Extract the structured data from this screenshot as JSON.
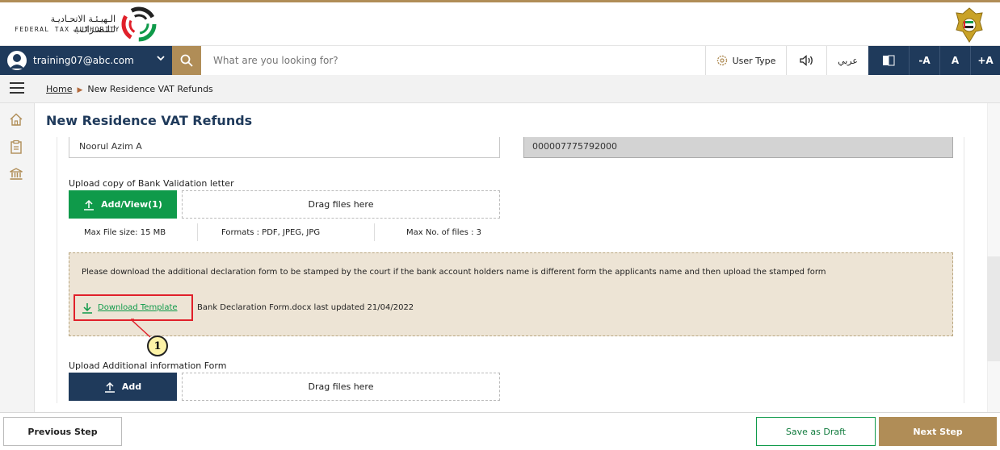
{
  "header": {
    "logo_arabic": "الـهيـئـة الاتحـاديـة لـلـضـرائـب",
    "logo_english": "FEDERAL TAX AUTHORITY"
  },
  "navbar": {
    "user_email": "training07@abc.com",
    "search_placeholder": "What are you looking for?",
    "user_type_label": "User Type",
    "arabic_label": "عربي",
    "font_decrease": "-A",
    "font_normal": "A",
    "font_increase": "+A"
  },
  "breadcrumb": {
    "home": "Home",
    "current": "New Residence VAT Refunds"
  },
  "page": {
    "title": "New Residence VAT Refunds"
  },
  "form": {
    "account_holder_value": "Noorul Azim A",
    "account_number_value": "000007775792000",
    "bank_letter": {
      "label": "Upload copy of Bank Validation letter",
      "button": "Add/View(1)",
      "dropzone": "Drag files here",
      "max_size": "Max File size: 15 MB",
      "formats": "Formats : PDF, JPEG, JPG",
      "max_files": "Max No. of files : 3"
    },
    "notice": {
      "text": "Please download the additional declaration form to be stamped by the court if the bank account holders name is different form the applicants name and then upload the stamped form",
      "download_label": "Download Template",
      "file_info": "Bank Declaration Form.docx last updated 21/04/2022"
    },
    "callout_number": "1",
    "additional_form": {
      "label": "Upload Additional information Form",
      "button": "Add",
      "dropzone": "Drag files here"
    }
  },
  "footer": {
    "previous": "Previous Step",
    "save_draft": "Save as Draft",
    "next": "Next Step"
  },
  "colors": {
    "navy": "#1f3a5b",
    "gold": "#b08d57",
    "green": "#0f9a4a",
    "highlight_red": "#e0202a",
    "notice_bg": "#ede4d5"
  }
}
